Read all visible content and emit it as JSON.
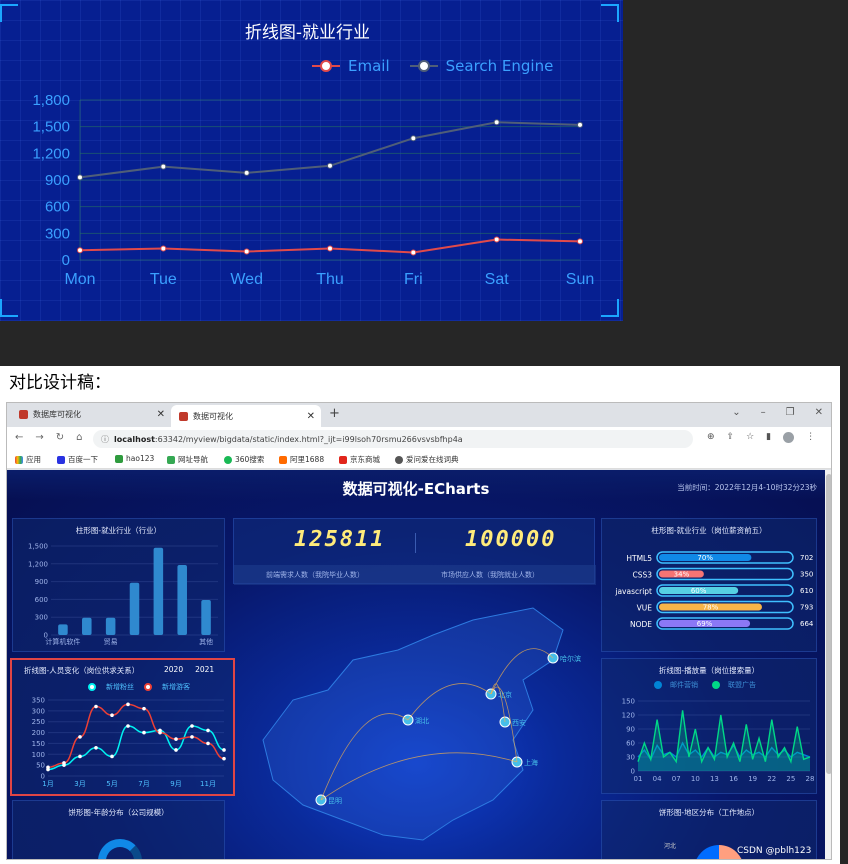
{
  "top_chart": {
    "title": "折线图-就业行业",
    "legend": [
      "Email",
      "Search Engine"
    ],
    "chart_data": {
      "type": "line",
      "title": "折线图-就业行业",
      "categories": [
        "Mon",
        "Tue",
        "Wed",
        "Thu",
        "Fri",
        "Sat",
        "Sun"
      ],
      "series": [
        {
          "name": "Email",
          "values": [
            110,
            130,
            95,
            130,
            85,
            230,
            210
          ],
          "color": "#e14a4a"
        },
        {
          "name": "Search Engine",
          "values": [
            930,
            1050,
            980,
            1060,
            1370,
            1550,
            1520
          ],
          "color": "#4f5e78"
        }
      ],
      "ylim": [
        0,
        1800
      ],
      "yticks": [
        "0",
        "300",
        "600",
        "900",
        "1,200",
        "1,500",
        "1,800"
      ],
      "grid": true,
      "legend_position": "top-right"
    }
  },
  "compare_label": "对比设计稿：",
  "browser": {
    "tabs": [
      {
        "label": "数据库可视化"
      },
      {
        "label": "数据可视化"
      }
    ],
    "url_host": "localhost",
    "url_rest": ":63342/myview/bigdata/static/index.html?_ijt=i99lsoh70rsmu266vsvsbfhp4a",
    "bookmarks": [
      "应用",
      "百度一下",
      "hao123",
      "网址导航",
      "360搜索",
      "阿里1688",
      "京东商城",
      "爱问爱在线词典"
    ]
  },
  "dashboard": {
    "title": "数据可视化-ECharts",
    "time": "当前时间：2022年12月4-10时32分23秒",
    "kpi": [
      {
        "value": "125811",
        "label": "前端需求人数（我院毕业人数）"
      },
      {
        "value": "100000",
        "label": "市场供应人数（我院就业人数）"
      }
    ],
    "panel_bar": {
      "title": "柱形图-就业行业（行业）",
      "chart_data": {
        "type": "bar",
        "categories": [
          "计算机软件",
          "",
          "贸易",
          "",
          "",
          "",
          "其他"
        ],
        "values": [
          180,
          290,
          290,
          880,
          1470,
          1180,
          590
        ],
        "ylim": [
          0,
          1500
        ],
        "yticks": [
          "0",
          "300",
          "600",
          "900",
          "1,200",
          "1,500"
        ]
      }
    },
    "panel_line": {
      "title": "折线图-人员变化（岗位供求关系）",
      "years": [
        "2020",
        "2021"
      ],
      "legend": [
        "新增粉丝",
        "新增游客"
      ],
      "chart_data": {
        "type": "line",
        "categories": [
          "1月",
          "2月",
          "3月",
          "4月",
          "5月",
          "6月",
          "7月",
          "8月",
          "9月",
          "10月",
          "11月",
          "12月"
        ],
        "xlabels_shown": [
          "1月",
          "3月",
          "5月",
          "7月",
          "9月",
          "11月"
        ],
        "series": [
          {
            "name": "新增粉丝",
            "values": [
              30,
              50,
              90,
              130,
              90,
              230,
              200,
              210,
              120,
              230,
              210,
              120
            ]
          },
          {
            "name": "新增游客",
            "values": [
              40,
              60,
              180,
              320,
              280,
              330,
              310,
              200,
              170,
              180,
              150,
              80
            ]
          }
        ],
        "ylim": [
          0,
          350
        ],
        "yticks": [
          "0",
          "50",
          "100",
          "150",
          "200",
          "250",
          "300",
          "350"
        ]
      }
    },
    "panel_pie_age": {
      "title": "饼形图-年龄分布（公司规模）"
    },
    "panel_skills": {
      "title": "柱形图-就业行业（岗位薪资前五）",
      "chart_data": {
        "type": "bar",
        "categories": [
          "HTML5",
          "CSS3",
          "javascript",
          "VUE",
          "NODE"
        ],
        "values": [
          70,
          34,
          60,
          78,
          69
        ],
        "labels": [
          "70%",
          "34%",
          "60%",
          "78%",
          "69%"
        ],
        "totals": [
          "702",
          "350",
          "610",
          "793",
          "664"
        ],
        "colors": [
          "#1089e7",
          "#f57474",
          "#56d0e3",
          "#f8b448",
          "#8b78f6"
        ]
      }
    },
    "panel_play": {
      "title": "折线图-播放量（岗位搜索量）",
      "legend": [
        "邮件营销",
        "联盟广告"
      ],
      "chart_data": {
        "type": "line",
        "xlabels": [
          "01",
          "04",
          "07",
          "10",
          "13",
          "16",
          "19",
          "22",
          "25",
          "28"
        ],
        "ylim": [
          0,
          150
        ],
        "yticks": [
          "0",
          "30",
          "60",
          "90",
          "120",
          "150"
        ],
        "series": [
          {
            "name": "邮件营销",
            "values": [
              30,
              45,
              25,
              55,
              35,
              40,
              30,
              60,
              35,
              45,
              30,
              50,
              30,
              40,
              35,
              55,
              30,
              45,
              35,
              40,
              30,
              50,
              35,
              45,
              30,
              40,
              35,
              30
            ]
          },
          {
            "name": "联盟广告",
            "values": [
              20,
              60,
              25,
              110,
              30,
              40,
              20,
              130,
              30,
              90,
              20,
              50,
              25,
              120,
              30,
              60,
              20,
              100,
              25,
              70,
              20,
              110,
              30,
              50,
              20,
              95,
              25,
              30
            ]
          }
        ]
      }
    },
    "panel_pie_area": {
      "title": "饼形图-地区分布（工作地点）",
      "label": "河北"
    },
    "map_cities": [
      "哈尔滨",
      "北京",
      "湖北",
      "西安",
      "上海",
      "昆明"
    ],
    "watermark": "CSDN @pblh123"
  },
  "colors": {
    "accent": "#27a6ff",
    "email": "#e14a4a",
    "search": "#4f5e78"
  }
}
